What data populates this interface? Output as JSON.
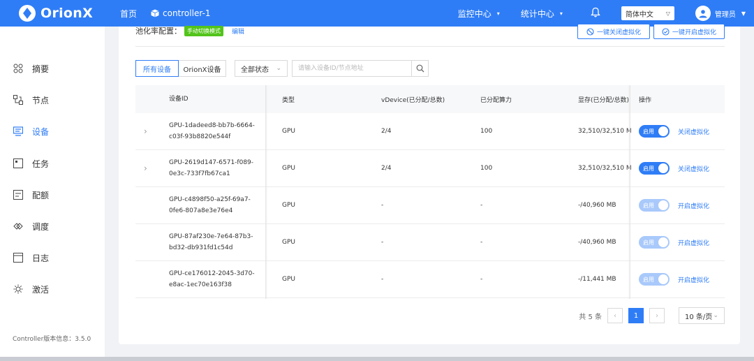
{
  "header": {
    "logo_text": "OrionX",
    "home": "首页",
    "controller": "controller-1",
    "menus": [
      {
        "label": "监控中心"
      },
      {
        "label": "统计中心"
      }
    ],
    "language": "简体中文",
    "user": "管理员",
    "brand_color": "#2f7df6"
  },
  "sidebar": {
    "items": [
      {
        "label": "摘要",
        "icon": "grid-dots-icon"
      },
      {
        "label": "节点",
        "icon": "node-icon"
      },
      {
        "label": "设备",
        "icon": "device-icon"
      },
      {
        "label": "任务",
        "icon": "task-icon"
      },
      {
        "label": "配额",
        "icon": "quota-icon"
      },
      {
        "label": "调度",
        "icon": "schedule-icon"
      },
      {
        "label": "日志",
        "icon": "log-icon"
      },
      {
        "label": "激活",
        "icon": "activate-icon"
      }
    ],
    "active_index": 2,
    "version": "Controller版本信息：3.5.0"
  },
  "pool": {
    "label": "池化率配置：",
    "mode": "手动切换模式",
    "edit": "编辑",
    "close_all": "一键关闭虚拟化",
    "open_all": "一键开启虚拟化"
  },
  "filters": {
    "tabs": [
      "所有设备",
      "OrionX设备"
    ],
    "status": "全部状态",
    "search_placeholder": "请输入设备ID/节点地址"
  },
  "table": {
    "headers": [
      "设备ID",
      "类型",
      "vDevice(已分配/总数)",
      "已分配算力",
      "显存(已分配/总数)",
      "操作"
    ],
    "rows": [
      {
        "id1": "GPU-1dadeed8-bb7b-6664-",
        "id2": "c03f-93b8820e544f",
        "type": "GPU",
        "vdevice": "2/4",
        "power": "100",
        "memory": "32,510/32,510 M",
        "toggle": "启用",
        "enabled": true,
        "action": "关闭虚拟化",
        "expandable": true
      },
      {
        "id1": "GPU-2619d147-6571-f089-",
        "id2": "0e3c-733f7fb67ca1",
        "type": "GPU",
        "vdevice": "2/4",
        "power": "100",
        "memory": "32,510/32,510 M",
        "toggle": "启用",
        "enabled": true,
        "action": "关闭虚拟化",
        "expandable": true
      },
      {
        "id1": "GPU-c4898f50-a25f-69a7-",
        "id2": "0fe6-807a8e3e76e4",
        "type": "GPU",
        "vdevice": "-",
        "power": "-",
        "memory": "-/40,960 MB",
        "toggle": "启用",
        "enabled": false,
        "action": "开启虚拟化",
        "expandable": false
      },
      {
        "id1": "GPU-87af230e-7e64-87b3-",
        "id2": "bd32-db931fd1c54d",
        "type": "GPU",
        "vdevice": "-",
        "power": "-",
        "memory": "-/40,960 MB",
        "toggle": "启用",
        "enabled": false,
        "action": "开启虚拟化",
        "expandable": false
      },
      {
        "id1": "GPU-ce176012-2045-3d70-",
        "id2": "e8ac-1ec70e163f38",
        "type": "GPU",
        "vdevice": "-",
        "power": "-",
        "memory": "-/11,441 MB",
        "toggle": "启用",
        "enabled": false,
        "action": "开启虚拟化",
        "expandable": false
      }
    ]
  },
  "pagination": {
    "total": "共 5 条",
    "current": "1",
    "page_size": "10 条/页"
  }
}
